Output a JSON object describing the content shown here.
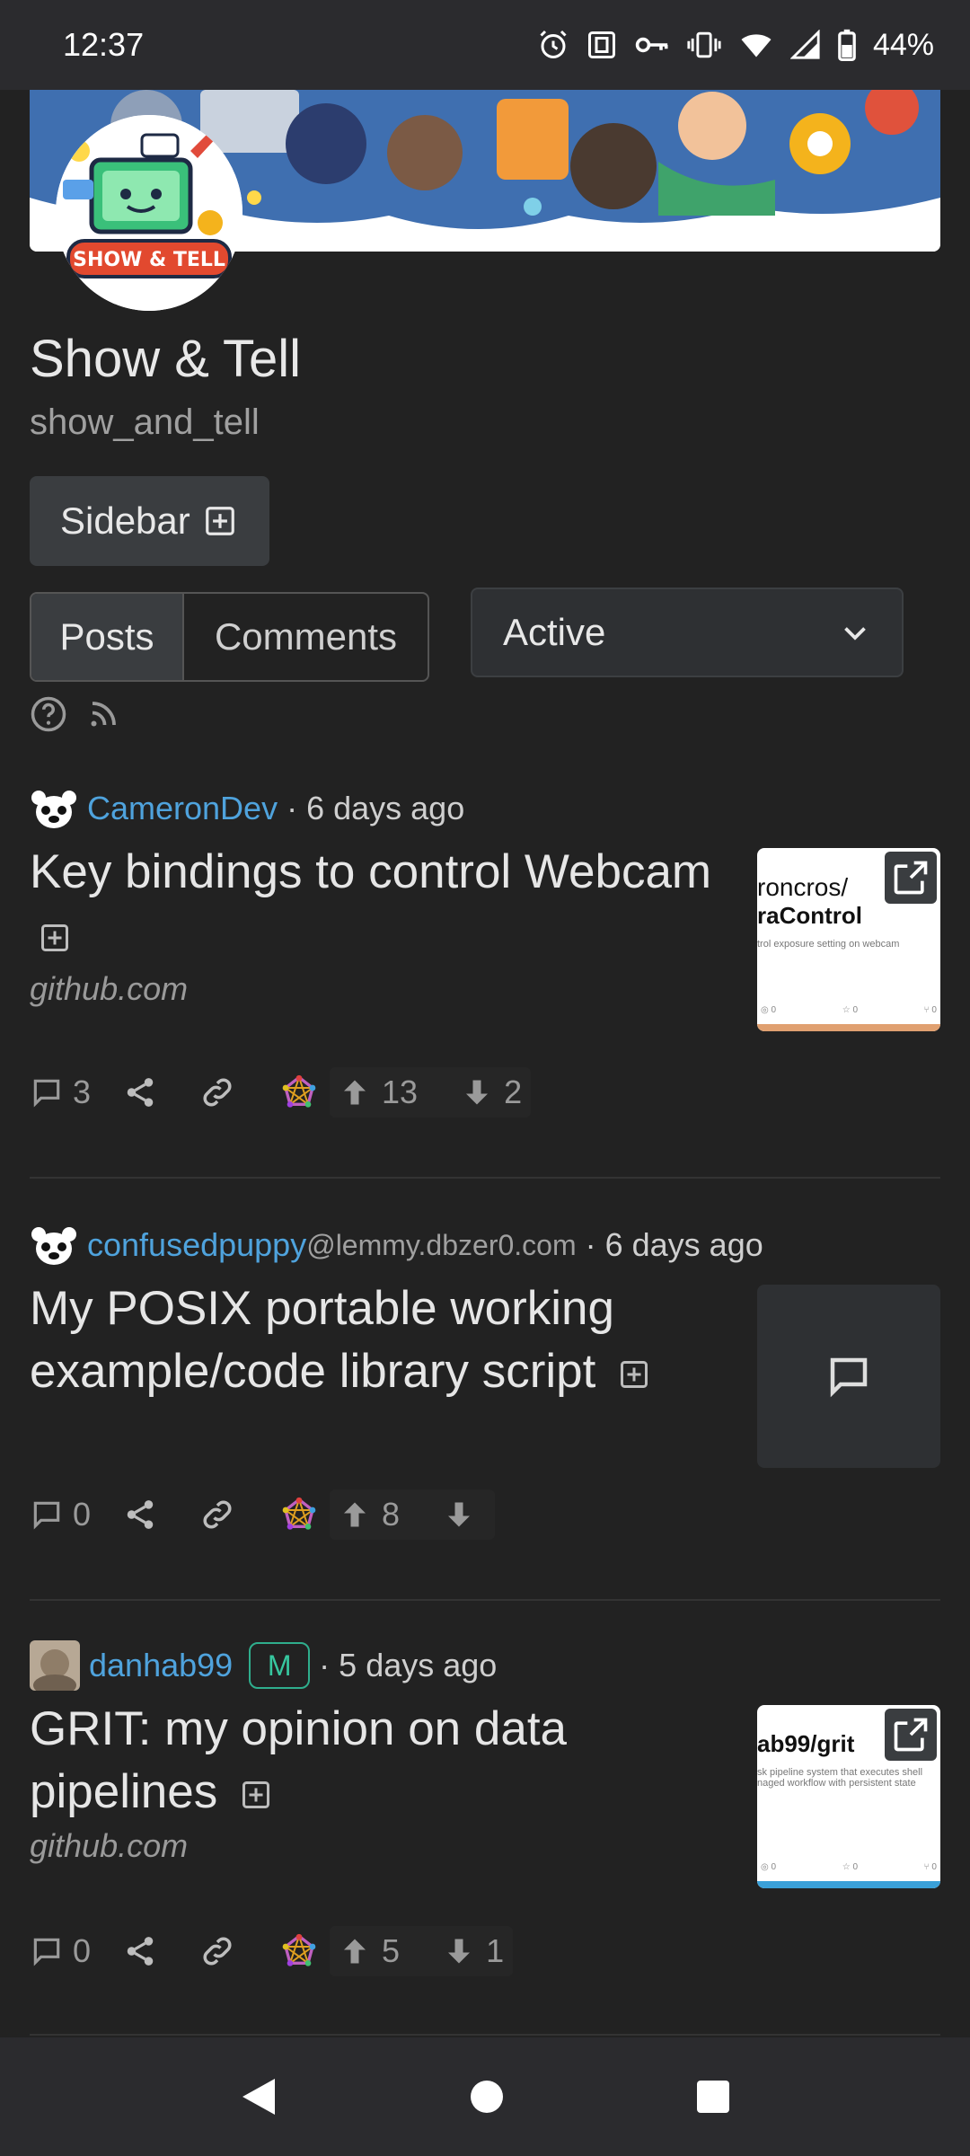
{
  "status_bar": {
    "time": "12:37",
    "battery": "44%",
    "icons": [
      "alarm-icon",
      "nfc-icon",
      "vpn-key-icon",
      "vibrate-icon",
      "wifi-icon",
      "signal-icon",
      "battery-icon"
    ]
  },
  "community": {
    "title": "Show & Tell",
    "handle": "show_and_tell",
    "logo_text": "SHOW & TELL"
  },
  "sidebar_button": {
    "label": "Sidebar"
  },
  "tabs": [
    {
      "label": "Posts",
      "active": true
    },
    {
      "label": "Comments",
      "active": false
    }
  ],
  "sort": {
    "selected": "Active"
  },
  "posts": [
    {
      "user": "CameronDev",
      "instance": "",
      "time": "6 days ago",
      "title": "Key bindings to control Webcam",
      "domain": "github.com",
      "comments": "3",
      "upvotes": "13",
      "downvotes": "2",
      "thumb_line1": "roncros/",
      "thumb_line2": "raControl",
      "thumb_small": "trol exposure setting on webcam"
    },
    {
      "user": "confusedpuppy",
      "instance": "@lemmy.dbzer0.com",
      "time": "6 days ago",
      "title": "My POSIX portable working example/code library script",
      "domain": "",
      "comments": "0",
      "upvotes": "8",
      "downvotes": ""
    },
    {
      "user": "danhab99",
      "instance": "",
      "badge": "M",
      "time": "5 days ago",
      "title": "GRIT: my opinion on data pipelines",
      "domain": "github.com",
      "comments": "0",
      "upvotes": "5",
      "downvotes": "1",
      "thumb_line1": "ab99/grit",
      "thumb_small": "sk pipeline system that executes shell naged workflow with persistent state"
    }
  ],
  "colors": {
    "background": "#222222",
    "accent_link": "#4fa3dd",
    "mod_badge": "#37c79f"
  }
}
